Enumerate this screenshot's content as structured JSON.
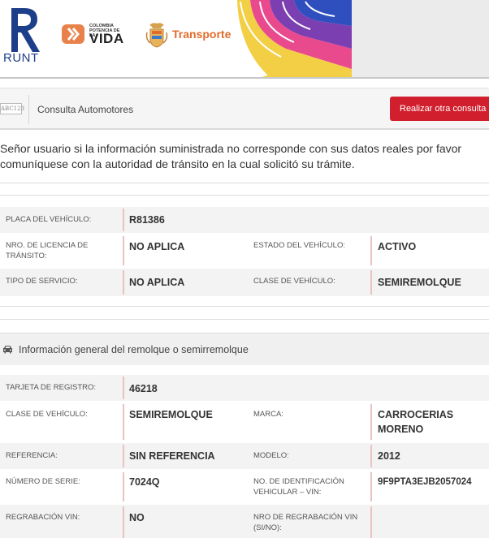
{
  "header": {
    "runt_logo_text": "RUNT",
    "vida_logo_small": [
      "COLOMBIA",
      "POTENCIA DE LA"
    ],
    "vida_logo_big": "VIDA",
    "transporte_logo_text": "Transporte"
  },
  "toolbar": {
    "captcha_text": "ABC123",
    "title": "Consulta Automotores",
    "button_label": "Realizar otra consulta"
  },
  "notice": "Señor usuario si la información suministrada no corresponde con sus datos reales por favor comuníquese con la autoridad de tránsito en la cual solicitó su trámite.",
  "vehicle": {
    "placa_label": "PLACA DEL VEHÍCULO:",
    "placa_value": "R81386",
    "licencia_label": "NRO. DE LICENCIA DE TRÁNSITO:",
    "licencia_value": "NO APLICA",
    "estado_label": "ESTADO DEL VEHÍCULO:",
    "estado_value": "ACTIVO",
    "servicio_label": "TIPO DE SERVICIO:",
    "servicio_value": "NO APLICA",
    "clase_label": "CLASE DE VEHÍCULO:",
    "clase_value": "SEMIREMOLQUE"
  },
  "section": {
    "icon": "car-icon",
    "title": "Información general del remolque o semirremolque"
  },
  "trailer": {
    "tarjeta_label": "TARJETA DE REGISTRO:",
    "tarjeta_value": "46218",
    "clase_label": "CLASE DE VEHÍCULO:",
    "clase_value": "SEMIREMOLQUE",
    "marca_label": "MARCA:",
    "marca_value": "CARROCERIAS MORENO",
    "referencia_label": "REFERENCIA:",
    "referencia_value": "SIN REFERENCIA",
    "modelo_label": "MODELO:",
    "modelo_value": "2012",
    "serie_label": "NÚMERO DE SERIE:",
    "serie_value": "7024Q",
    "vin_label": "NO. DE IDENTIFICACIÓN VEHICULAR – VIN:",
    "vin_value": "9F9PTA3EJB2057024",
    "regrabacion_label": "REGRABACIÓN VIN:",
    "regrabacion_value": "NO",
    "nro_regrabacion_label": "NRO DE REGRABACIÓN VIN (SI/NO):",
    "nro_regrabacion_value": ""
  },
  "colors": {
    "accent_red": "#d11f2d",
    "label_bar": "#e7c3c3",
    "runt_blue": "#1d3f8a"
  }
}
